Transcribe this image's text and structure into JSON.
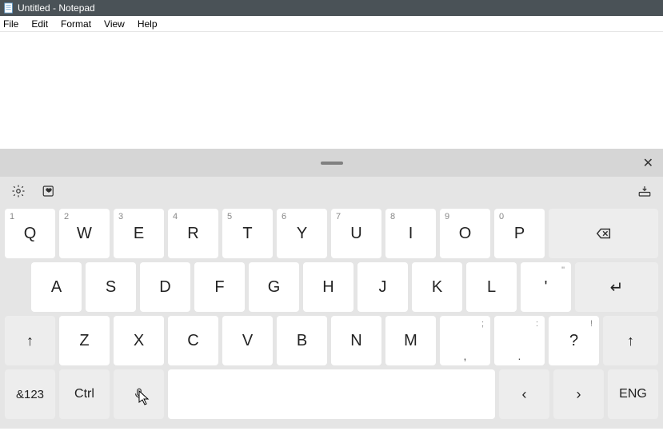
{
  "window": {
    "title": "Untitled - Notepad"
  },
  "menu": {
    "items": [
      "File",
      "Edit",
      "Format",
      "View",
      "Help"
    ]
  },
  "keyboard": {
    "row1": [
      {
        "sup": "1",
        "k": "Q"
      },
      {
        "sup": "2",
        "k": "W"
      },
      {
        "sup": "3",
        "k": "E"
      },
      {
        "sup": "4",
        "k": "R"
      },
      {
        "sup": "5",
        "k": "T"
      },
      {
        "sup": "6",
        "k": "Y"
      },
      {
        "sup": "7",
        "k": "U"
      },
      {
        "sup": "8",
        "k": "I"
      },
      {
        "sup": "9",
        "k": "O"
      },
      {
        "sup": "0",
        "k": "P"
      }
    ],
    "row2": [
      "A",
      "S",
      "D",
      "F",
      "G",
      "H",
      "J",
      "K",
      "L"
    ],
    "row2_punct": {
      "sup": "\"",
      "k": "'"
    },
    "row3": [
      "Z",
      "X",
      "C",
      "V",
      "B",
      "N",
      "M"
    ],
    "row3_p1": {
      "sup": ";",
      "k": ","
    },
    "row3_p2": {
      "sup": ":",
      "k": "."
    },
    "row3_p3": {
      "sup": "!",
      "k": "?"
    },
    "bottom": {
      "sym": "&123",
      "ctrl": "Ctrl",
      "lang": "ENG"
    },
    "glyphs": {
      "shift": "↑",
      "enter": "↵",
      "left": "‹",
      "right": "›",
      "close": "✕"
    }
  }
}
